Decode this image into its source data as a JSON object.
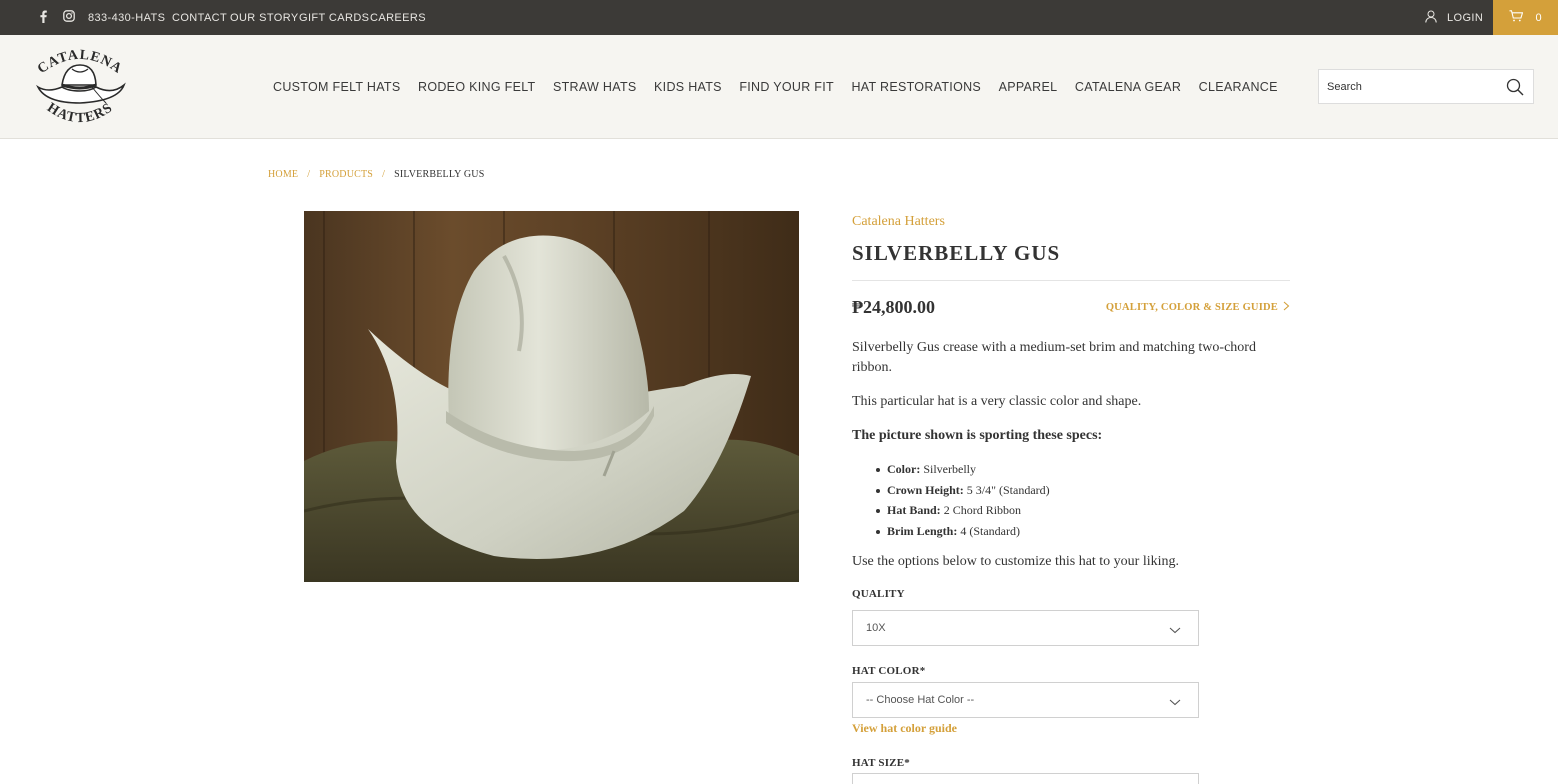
{
  "topbar": {
    "phone": "833-430-HATS",
    "links": [
      "CONTACT",
      "OUR STORY",
      "GIFT CARDS",
      "CAREERS"
    ],
    "login": "LOGIN",
    "cart_count": "0"
  },
  "header": {
    "nav": [
      "CUSTOM FELT HATS",
      "RODEO KING FELT",
      "STRAW HATS",
      "KIDS HATS",
      "FIND YOUR FIT",
      "HAT RESTORATIONS",
      "APPAREL",
      "CATALENA GEAR",
      "CLEARANCE"
    ],
    "search_placeholder": "Search"
  },
  "breadcrumb": {
    "home": "HOME",
    "products": "PRODUCTS",
    "current": "SILVERBELLY GUS",
    "sep": "/"
  },
  "product": {
    "brand": "Catalena Hatters",
    "title": "SILVERBELLY GUS",
    "price": "₱24,800.00",
    "guide_link": "QUALITY, COLOR & SIZE GUIDE",
    "desc1": "Silverbelly Gus crease with a medium-set brim and matching two-chord ribbon.",
    "desc2": "This particular hat is a very classic color and shape.",
    "specs_heading": "The picture shown is sporting these specs:",
    "specs": [
      {
        "label": "Color:",
        "value": " Silverbelly"
      },
      {
        "label": "Crown Height:",
        "value": " 5 3/4\" (Standard)"
      },
      {
        "label": "Hat Band:",
        "value": " 2 Chord Ribbon"
      },
      {
        "label": "Brim Length:",
        "value": " 4 (Standard)"
      }
    ],
    "options_intro": "Use the options below to customize this hat to your liking.",
    "quality_label": "QUALITY",
    "quality_value": "10X",
    "color_label": "HAT COLOR*",
    "color_value": "-- Choose Hat Color --",
    "color_guide": "View hat color guide",
    "size_label": "HAT SIZE*"
  },
  "colors": {
    "accent": "#d4a03a",
    "topbar": "#3c3a37",
    "header": "#f6f5f1"
  },
  "icons": [
    "facebook-icon",
    "instagram-icon",
    "user-icon",
    "cart-icon",
    "search-icon",
    "chevron-down-icon",
    "chevron-right-icon"
  ]
}
